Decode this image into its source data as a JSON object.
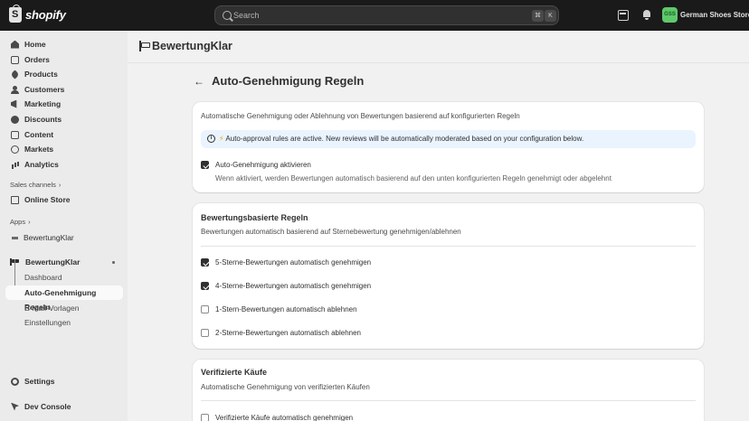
{
  "topbar": {
    "logo_text": "shopify",
    "search_placeholder": "Search",
    "shortcut_keys": [
      "⌘",
      "K"
    ],
    "store_initials": "GSS",
    "store_name": "German Shoes Store"
  },
  "sidebar": {
    "items": [
      {
        "label": "Home",
        "icon": "home-icon"
      },
      {
        "label": "Orders",
        "icon": "orders-icon"
      },
      {
        "label": "Products",
        "icon": "tag-icon"
      },
      {
        "label": "Customers",
        "icon": "person-icon"
      },
      {
        "label": "Marketing",
        "icon": "megaphone-icon"
      },
      {
        "label": "Discounts",
        "icon": "discount-icon"
      },
      {
        "label": "Content",
        "icon": "content-icon"
      },
      {
        "label": "Markets",
        "icon": "globe-icon"
      },
      {
        "label": "Analytics",
        "icon": "chart-icon"
      }
    ],
    "sales_channels_label": "Sales channels",
    "online_store": "Online Store",
    "apps_label": "Apps",
    "app_pinned": "BewertungKlar",
    "app_expanded": "BewertungKlar",
    "app_subitems": [
      "Dashboard",
      "Auto-Genehmigung Regeln",
      "E-Mail-Vorlagen",
      "Einstellungen"
    ],
    "settings": "Settings",
    "dev_console": "Dev Console"
  },
  "app_header": {
    "brand": "BewertungKlar"
  },
  "page": {
    "title": "Auto-Genehmigung Regeln"
  },
  "card1": {
    "description": "Automatische Genehmigung oder Ablehnung von Bewertungen basierend auf konfigurierten Regeln",
    "banner_text": "Auto-approval rules are active. New reviews will be automatically moderated based on your configuration below.",
    "checkbox_label": "Auto-Genehmigung aktivieren",
    "checkbox_checked": true,
    "checkbox_help": "Wenn aktiviert, werden Bewertungen automatisch basierend auf den unten konfigurierten Regeln genehmigt oder abgelehnt"
  },
  "card2": {
    "title": "Bewertungsbasierte Regeln",
    "description": "Bewertungen automatisch basierend auf Sternebewertung genehmigen/ablehnen",
    "rules": [
      {
        "label": "5-Sterne-Bewertungen automatisch genehmigen",
        "checked": true
      },
      {
        "label": "4-Sterne-Bewertungen automatisch genehmigen",
        "checked": true
      },
      {
        "label": "1-Stern-Bewertungen automatisch ablehnen",
        "checked": false
      },
      {
        "label": "2-Sterne-Bewertungen automatisch ablehnen",
        "checked": false
      }
    ]
  },
  "card3": {
    "title": "Verifizierte Käufe",
    "description": "Automatische Genehmigung von verifizierten Käufen",
    "rule_label": "Verifizierte Käufe automatisch genehmigen",
    "rule_checked": false
  }
}
